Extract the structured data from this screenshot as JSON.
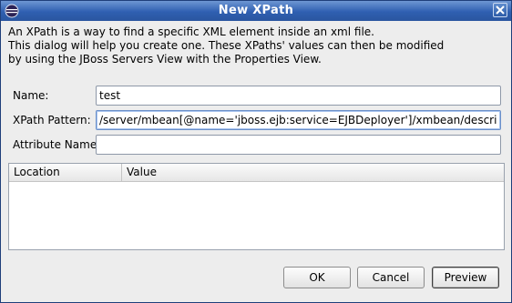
{
  "window": {
    "title": "New XPath",
    "icon": "eclipse-icon",
    "close_icon": "close-icon"
  },
  "description": {
    "lines": [
      "An XPath is a way to find a specific XML element inside an xml file.",
      "This dialog will help you create one. These XPaths' values can then be modified",
      "by using the JBoss Servers View with the Properties View."
    ]
  },
  "form": {
    "name_label": "Name:",
    "name_value": "test",
    "xpath_label": "XPath Pattern:",
    "xpath_value": "/server/mbean[@name='jboss.ejb:service=EJBDeployer']/xmbean/description",
    "attribute_label": "Attribute Name:",
    "attribute_value": ""
  },
  "results_table": {
    "columns": [
      "Location",
      "Value"
    ],
    "rows": []
  },
  "buttons": {
    "ok": "OK",
    "cancel": "Cancel",
    "preview": "Preview"
  }
}
